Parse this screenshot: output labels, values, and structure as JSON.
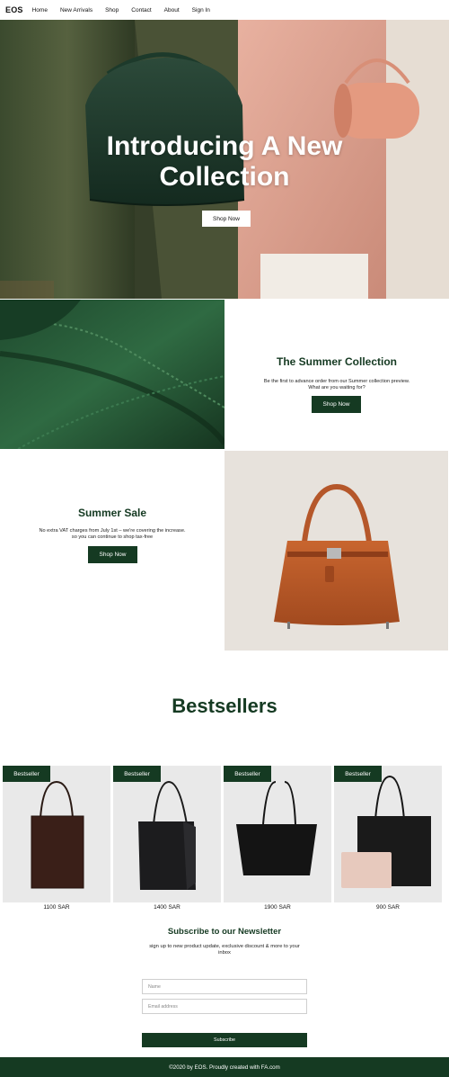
{
  "nav": {
    "brand": "EOS",
    "links": [
      "Home",
      "New Arrivals",
      "Shop",
      "Contact",
      "About",
      "Sign In"
    ]
  },
  "hero": {
    "title_line1": "Introducing A New",
    "title_line2": "Collection",
    "button": "Shop Now"
  },
  "summer_collection": {
    "title": "The Summer Collection",
    "text_line1": "Be the first to advance order from our Summer collection preview.",
    "text_line2": "What are you waiting for?",
    "button": "Shop Now"
  },
  "summer_sale": {
    "title": "Summer Sale",
    "text_line1": "No extra VAT charges from July 1st – we're covering the increase.",
    "text_line2": "so you can continue to shop tax-free",
    "button": "Shop Now"
  },
  "bestsellers": {
    "title": "Bestsellers",
    "products": [
      {
        "badge": "Bestseller",
        "price": "1100 SAR"
      },
      {
        "badge": "Bestseller",
        "price": "1400 SAR"
      },
      {
        "badge": "Bestseller",
        "price": "1900 SAR"
      },
      {
        "badge": "Bestseller",
        "price": "900 SAR"
      }
    ]
  },
  "newsletter": {
    "title": "Subscribe to our Newsletter",
    "sub_line1": "sign up to new product update, exclusive discount & more to your",
    "sub_line2": "inbox",
    "name_placeholder": "Name",
    "email_placeholder": "Email address",
    "button": "Subscribe"
  },
  "footer": {
    "text": "©2020 by EOS. Proudly created with FA.com"
  },
  "colors": {
    "brand_green": "#153a22",
    "background": "#ffffff"
  }
}
